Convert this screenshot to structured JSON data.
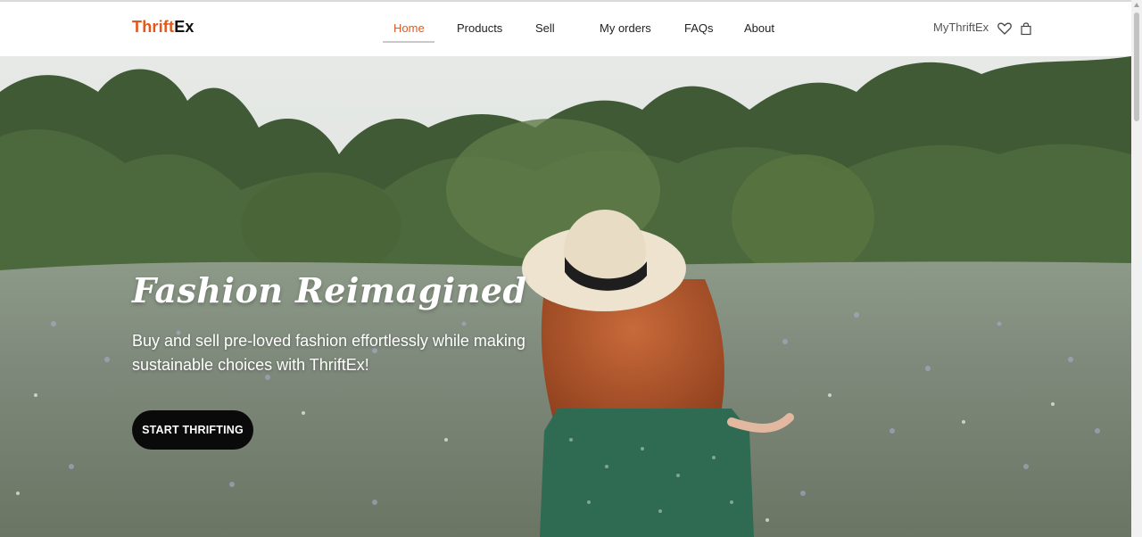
{
  "brand": {
    "part1": "Thrift",
    "part2": "Ex"
  },
  "nav": {
    "items": [
      {
        "label": "Home",
        "active": true
      },
      {
        "label": "Products",
        "active": false
      },
      {
        "label": "Sell",
        "active": false
      },
      {
        "label": "My orders",
        "active": false
      },
      {
        "label": "FAQs",
        "active": false
      },
      {
        "label": "About",
        "active": false
      }
    ]
  },
  "account": {
    "label": "MyThriftEx"
  },
  "icons": {
    "wishlist": "heart-icon",
    "cart": "shopping-bag-icon"
  },
  "hero": {
    "title": "Fashion Reimagined",
    "subtitle": "Buy and sell pre-loved fashion effortlessly while making sustainable choices with ThriftEx!",
    "cta": "START THRIFTING"
  },
  "colors": {
    "accent": "#e4571b",
    "cta_bg": "#0a0a0a",
    "text": "#222222"
  }
}
